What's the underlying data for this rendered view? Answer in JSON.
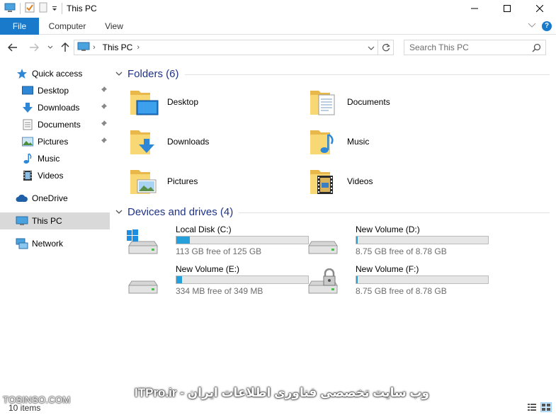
{
  "window": {
    "title": "This PC",
    "controls": {
      "minimize": "─",
      "maximize": "☐",
      "close": "✕"
    }
  },
  "ribbon": {
    "tabs": [
      {
        "label": "File"
      },
      {
        "label": "Computer"
      },
      {
        "label": "View"
      }
    ],
    "help_label": "?"
  },
  "address": {
    "path": "This PC",
    "search_placeholder": "Search This PC"
  },
  "nav": {
    "items": [
      {
        "label": "Quick access",
        "icon": "star-icon"
      },
      {
        "label": "Desktop",
        "icon": "desktop-icon",
        "pinned": true
      },
      {
        "label": "Downloads",
        "icon": "download-arrow-icon",
        "pinned": true
      },
      {
        "label": "Documents",
        "icon": "document-icon",
        "pinned": true
      },
      {
        "label": "Pictures",
        "icon": "pictures-icon",
        "pinned": true
      },
      {
        "label": "Music",
        "icon": "music-note-icon"
      },
      {
        "label": "Videos",
        "icon": "film-icon"
      },
      {
        "label": "OneDrive",
        "icon": "cloud-icon"
      },
      {
        "label": "This PC",
        "icon": "computer-icon",
        "selected": true
      },
      {
        "label": "Network",
        "icon": "network-icon"
      }
    ]
  },
  "folders": {
    "header": "Folders (6)",
    "items": [
      {
        "name": "Desktop",
        "icon": "desktop-folder-icon"
      },
      {
        "name": "Documents",
        "icon": "documents-folder-icon"
      },
      {
        "name": "Downloads",
        "icon": "downloads-folder-icon"
      },
      {
        "name": "Music",
        "icon": "music-folder-icon"
      },
      {
        "name": "Pictures",
        "icon": "pictures-folder-icon"
      },
      {
        "name": "Videos",
        "icon": "videos-folder-icon"
      }
    ]
  },
  "drives": {
    "header": "Devices and drives (4)",
    "items": [
      {
        "name": "Local Disk (C:)",
        "free": "113 GB free of 125 GB",
        "used_fraction": 0.1,
        "icon": "windows-drive-icon"
      },
      {
        "name": "New Volume (D:)",
        "free": "8.75 GB free of 8.78 GB",
        "used_fraction": 0.004,
        "icon": "drive-icon"
      },
      {
        "name": "New Volume (E:)",
        "free": "334 MB free of 349 MB",
        "used_fraction": 0.043,
        "icon": "drive-icon"
      },
      {
        "name": "New Volume (F:)",
        "free": "8.75 GB free of 8.78 GB",
        "used_fraction": 0.004,
        "icon": "locked-drive-icon"
      }
    ]
  },
  "status": {
    "items_count": "10 items"
  },
  "overlay": {
    "site_left": "TOSINSO.COM",
    "site_center": "وب سایت تخصصی فناوری اطلاعات ایران - ITPro.ir"
  },
  "colors": {
    "accent": "#1979ca",
    "group_title": "#1e3287",
    "bar_fill": "#26a0da",
    "folder_yellow": "#f8d775"
  }
}
